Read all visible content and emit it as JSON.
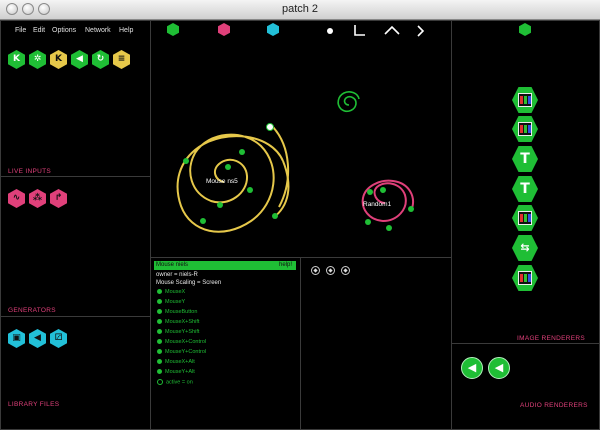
{
  "window": {
    "title": "patch 2"
  },
  "menu": {
    "items": [
      "File",
      "Edit",
      "Options",
      "Network",
      "Help"
    ]
  },
  "toolbar_icons": [
    "k-module-icon",
    "bug-module-icon",
    "k-module-icon",
    "speaker-module-icon",
    "refresh-module-icon",
    "stack-module-icon"
  ],
  "top_tools": [
    "green-hex-icon",
    "pink-hex-icon",
    "cyan-hex-icon",
    "dot-icon",
    "corner-icon",
    "caret-up-icon",
    "chevron-right-icon"
  ],
  "left_sections": {
    "live_inputs": "LIVE INPUTS",
    "generators": "GENERATORS",
    "library_files": "LIBRARY FILES"
  },
  "right_sections": {
    "image_renderers": "IMAGE RENDERERS",
    "audio_renderers": "AUDIO RENDERERS"
  },
  "canvas": {
    "node_mouse": "Mouse ns5",
    "node_random": "Random1"
  },
  "inspector": {
    "header": "Mouse niels",
    "help": "help!",
    "owner": "owner = niels-R",
    "scaling": "Mouse Scaling = Screen",
    "ports": [
      "MouseX",
      "MouseY",
      "MouseButton",
      "MouseX+Shift",
      "MouseY+Shift",
      "MouseX+Control",
      "MouseY+Control",
      "MouseX+Alt",
      "MouseY+Alt"
    ],
    "active": "active = on"
  },
  "colors": {
    "green": "#1fbe35",
    "pink": "#e0407a",
    "cyan": "#22c0d8",
    "yellow": "#e6c84a",
    "background": "#000000"
  }
}
